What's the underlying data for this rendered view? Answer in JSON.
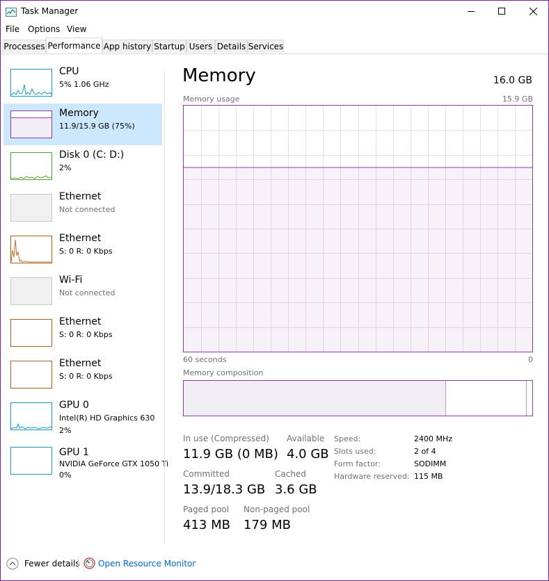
{
  "window": {
    "title": "Task Manager"
  },
  "menu": [
    "File",
    "Options",
    "View"
  ],
  "tabs": [
    "Processes",
    "Performance",
    "App history",
    "Startup",
    "Users",
    "Details",
    "Services"
  ],
  "sidebar": [
    {
      "name": "CPU",
      "line1": "5%  1.06 GHz",
      "line2": ""
    },
    {
      "name": "Memory",
      "line1": "11.9/15.9 GB (75%)",
      "line2": ""
    },
    {
      "name": "Disk 0 (C: D:)",
      "line1": "2%",
      "line2": ""
    },
    {
      "name": "Ethernet",
      "line1": "Not connected",
      "line2": ""
    },
    {
      "name": "Ethernet",
      "line1": "S: 0  R: 0 Kbps",
      "line2": ""
    },
    {
      "name": "Wi-Fi",
      "line1": "Not connected",
      "line2": ""
    },
    {
      "name": "Ethernet",
      "line1": "S: 0  R: 0 Kbps",
      "line2": ""
    },
    {
      "name": "Ethernet",
      "line1": "S: 0  R: 0 Kbps",
      "line2": ""
    },
    {
      "name": "GPU 0",
      "line1": "Intel(R) HD Graphics 630",
      "line2": "2%"
    },
    {
      "name": "GPU 1",
      "line1": "NVIDIA GeForce GTX 1050 Ti",
      "line2": "0%"
    }
  ],
  "panel": {
    "title": "Memory",
    "total": "16.0 GB",
    "usage_label": "Memory usage",
    "usage_max": "15.9 GB",
    "time_left": "60 seconds",
    "time_right": "0",
    "composition_label": "Memory composition",
    "usage_fraction": 0.75,
    "composition": {
      "in_use": 0.75,
      "modified": 0.23,
      "standby": 0.02
    }
  },
  "stats": {
    "in_use_label": "In use (Compressed)",
    "in_use_value": "11.9 GB (0 MB)",
    "available_label": "Available",
    "available_value": "4.0 GB",
    "committed_label": "Committed",
    "committed_value": "13.9/18.3 GB",
    "cached_label": "Cached",
    "cached_value": "3.6 GB",
    "paged_label": "Paged pool",
    "paged_value": "413 MB",
    "nonpaged_label": "Non-paged pool",
    "nonpaged_value": "179 MB"
  },
  "details": [
    {
      "label": "Speed:",
      "value": "2400 MHz"
    },
    {
      "label": "Slots used:",
      "value": "2 of 4"
    },
    {
      "label": "Form factor:",
      "value": "SODIMM"
    },
    {
      "label": "Hardware reserved:",
      "value": "115 MB"
    }
  ],
  "footer": {
    "fewer_details": "Fewer details",
    "resource_monitor": "Open Resource Monitor"
  },
  "colors": {
    "accent_memory": "#8b3ca8",
    "cpu": "#1797c4",
    "disk": "#4ea733",
    "ethernet": "#a65f1f",
    "selection": "#cce8ff"
  }
}
